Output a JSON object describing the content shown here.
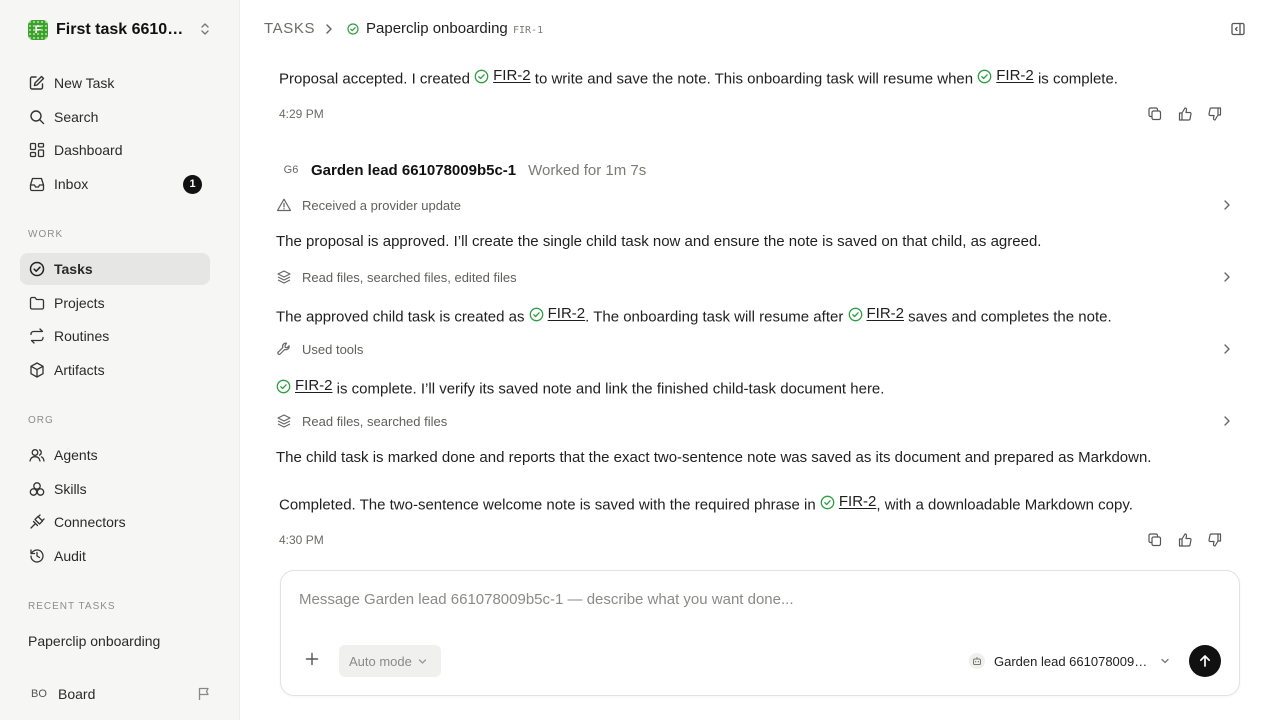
{
  "workspace": {
    "logo_letter": "F",
    "name": "First task 661078..."
  },
  "sidebar": {
    "primary": [
      {
        "label": "New Task",
        "icon": "edit-icon"
      },
      {
        "label": "Search",
        "icon": "search-icon"
      },
      {
        "label": "Dashboard",
        "icon": "dashboard-icon"
      },
      {
        "label": "Inbox",
        "icon": "inbox-icon",
        "badge": "1"
      }
    ],
    "work_heading": "WORK",
    "work": [
      {
        "label": "Tasks",
        "icon": "check-circle-icon",
        "active": true
      },
      {
        "label": "Projects",
        "icon": "folder-icon"
      },
      {
        "label": "Routines",
        "icon": "repeat-icon"
      },
      {
        "label": "Artifacts",
        "icon": "box-icon"
      }
    ],
    "org_heading": "ORG",
    "org": [
      {
        "label": "Agents",
        "icon": "users-icon"
      },
      {
        "label": "Skills",
        "icon": "skills-icon"
      },
      {
        "label": "Connectors",
        "icon": "plug-icon"
      },
      {
        "label": "Audit",
        "icon": "history-icon"
      }
    ],
    "recent_heading": "RECENT TASKS",
    "recent": [
      "Paperclip onboarding"
    ],
    "user": {
      "initials": "BO",
      "label": "Board"
    }
  },
  "header": {
    "root": "TASKS",
    "title": "Paperclip onboarding",
    "task_id": "FIR-1"
  },
  "thread": {
    "msg1": {
      "a": "Proposal accepted. I created",
      "ref": "FIR-2",
      "b": "to write and save the note. This onboarding task will resume when",
      "c": "is complete.",
      "time": "4:29 PM"
    },
    "agent": {
      "initials": "G6",
      "name": "Garden lead 661078009b5c-1",
      "worked": "Worked for 1m 7s"
    },
    "step1": "Received a provider update",
    "text1": "The proposal is approved. I’ll create the single child task now and ensure the note is saved on that child, as agreed.",
    "step2": "Read files, searched files, edited files",
    "text2": {
      "a": "The approved child task is created as",
      "b": ". The onboarding task will resume after",
      "c": "saves and completes the note."
    },
    "step3": "Used tools",
    "text3": {
      "a": "is complete. I’ll verify its saved note and link the finished child-task document here."
    },
    "step4": "Read files, searched files",
    "text4": "The child task is marked done and reports that the exact two-sentence note was saved as its document and prepared as Markdown.",
    "final": {
      "a": "Completed. The two-sentence welcome note is saved with the required phrase in",
      "b": ", with a downloadable Markdown copy.",
      "time": "4:30 PM"
    }
  },
  "composer": {
    "placeholder": "Message Garden lead 661078009b5c-1 — describe what you want done...",
    "mode": "Auto mode",
    "agent": "Garden lead 661078009b5c-1"
  },
  "colors": {
    "accent_green": "#2f9e44",
    "active_bg": "#e6e6e4",
    "send": "#111111"
  }
}
